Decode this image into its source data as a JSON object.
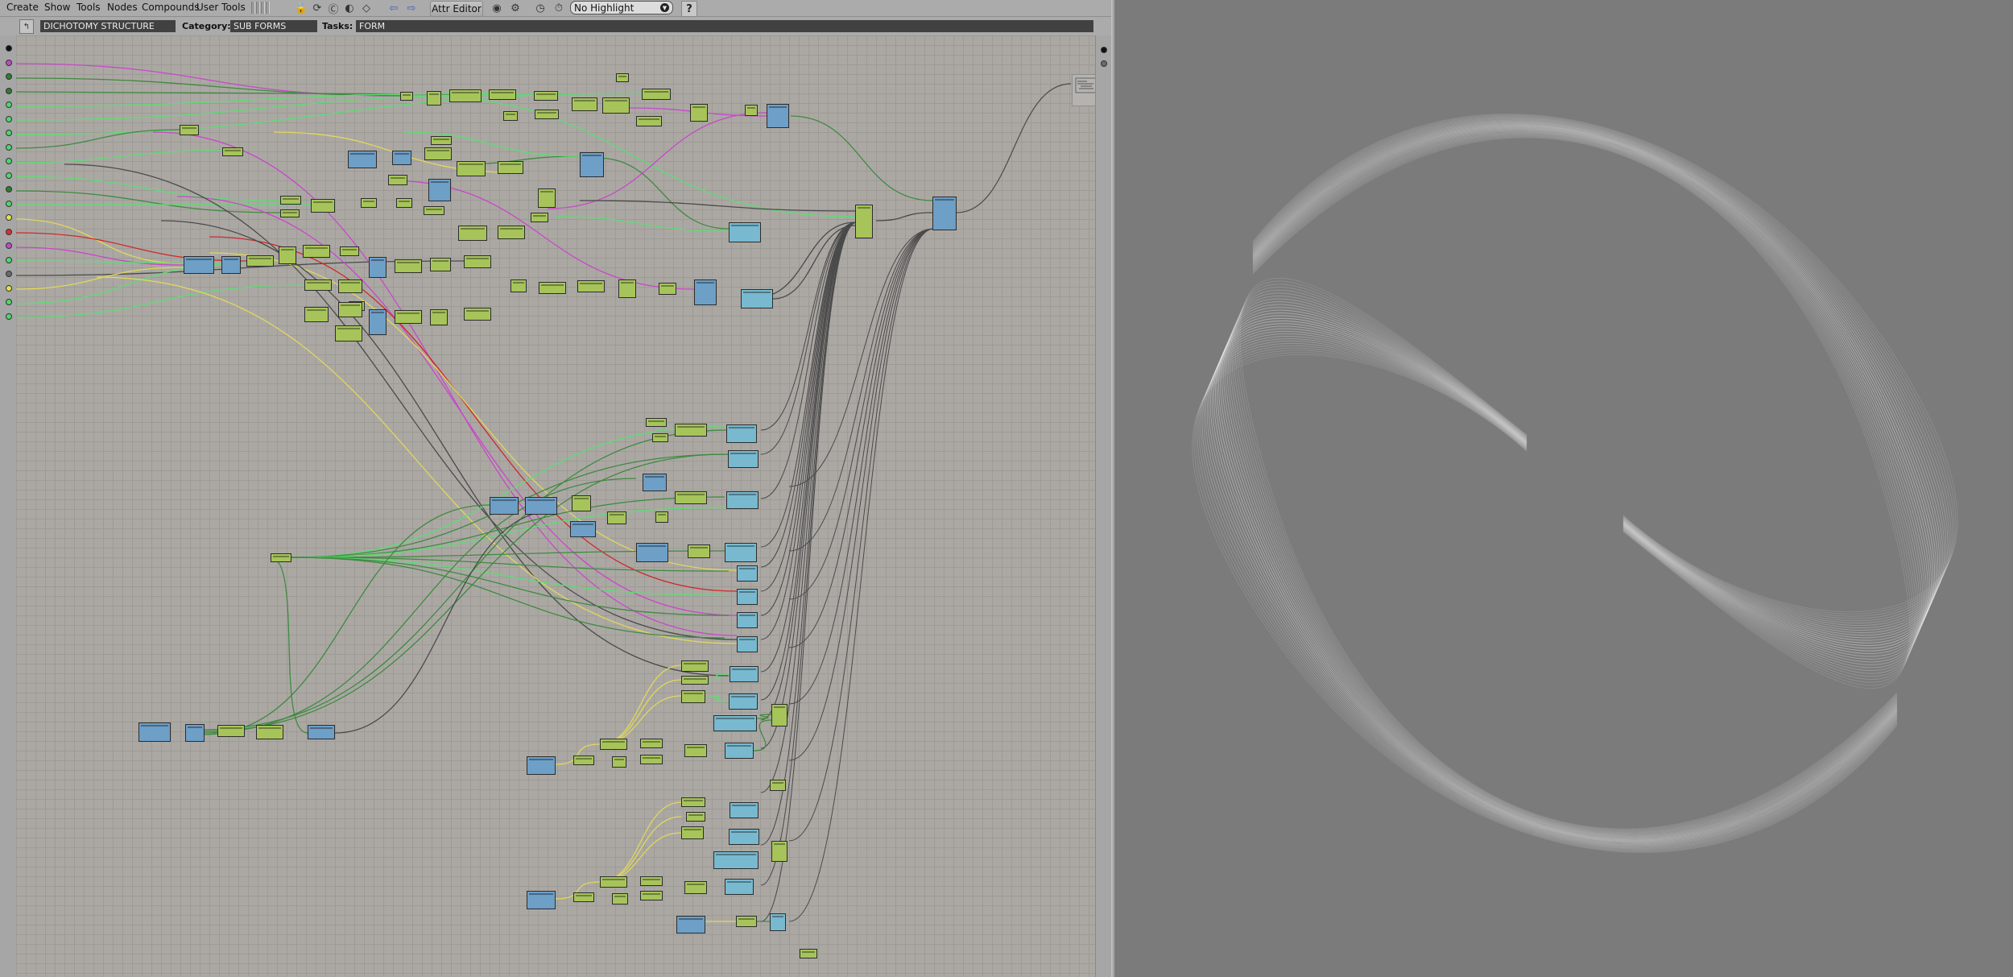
{
  "menubar": {
    "items": [
      "Create",
      "Show",
      "Tools",
      "Nodes",
      "Compounds",
      "User Tools"
    ],
    "attr_editor_label": "Attr Editor",
    "highlight": {
      "selected": "No Highlight"
    },
    "help_label": "?"
  },
  "pathbar": {
    "collapse_left": ">",
    "collapse_right": "<",
    "compound_name": "DICHOTOMY STRUCTURE",
    "category_label": "Category:",
    "category_value": "SUB FORMS",
    "tasks_label": "Tasks:",
    "tasks_value": "FORM"
  },
  "left_ports": [
    "#111111",
    "#c04ac8",
    "#2e7d2e",
    "#2e7d2e",
    "#4fd66a",
    "#4fd66a",
    "#4fd66a",
    "#4fd66a",
    "#4fd66a",
    "#4fd66a",
    "#2e7d2e",
    "#4fd66a",
    "#e4e04a",
    "#d83030",
    "#c04ac8",
    "#4fd66a",
    "#6a6a6a",
    "#e4e04a",
    "#4fd66a",
    "#4fd66a"
  ],
  "right_ports": [
    "#111111",
    "#6a6a6a"
  ],
  "colors": {
    "canvas": "#aba8a4",
    "node_green": "#a6c45a",
    "node_blue": "#6d9fc7",
    "node_cyan": "#78b9cf",
    "wire_green": "#5ddc72",
    "wire_dark_green": "#3f8a3f",
    "wire_yellow": "#e0d85a",
    "wire_magenta": "#c848c8",
    "wire_red": "#d02828",
    "wire_black": "#4a4a4a",
    "viewport_bg": "#7b7b7b",
    "curve_white": "#ffffff"
  },
  "icons": [
    "lock-icon",
    "refresh-icon",
    "cache-icon",
    "save-icon",
    "back-arrow-icon",
    "forward-arrow-icon",
    "eye-icon",
    "clock-icon",
    "timer-icon",
    "help-icon"
  ]
}
